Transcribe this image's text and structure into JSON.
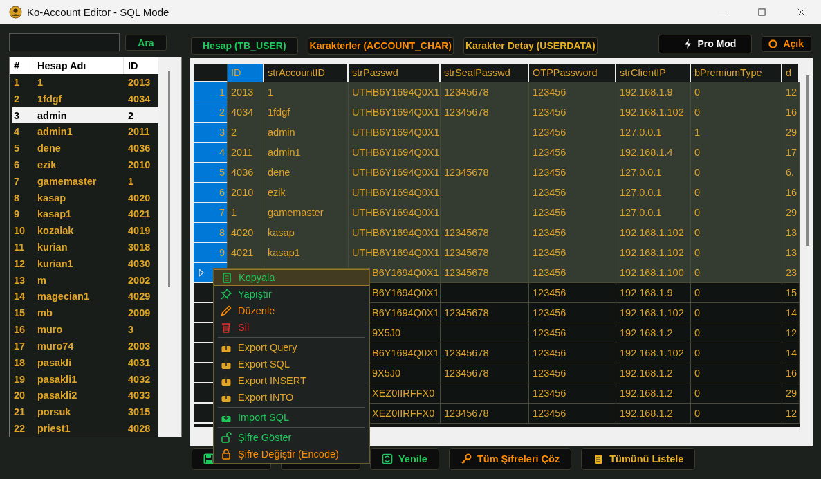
{
  "window": {
    "title": "Ko-Account Editor - SQL Mode"
  },
  "search": {
    "button": "Ara"
  },
  "account_list": {
    "columns": [
      "#",
      "Hesap Adı",
      "ID"
    ],
    "rows": [
      {
        "n": "1",
        "name": "1",
        "id": "2013",
        "selected": false
      },
      {
        "n": "2",
        "name": "1fdgf",
        "id": "4034",
        "selected": false
      },
      {
        "n": "3",
        "name": "admin",
        "id": "2",
        "selected": true
      },
      {
        "n": "4",
        "name": "admin1",
        "id": "2011",
        "selected": false
      },
      {
        "n": "5",
        "name": "dene",
        "id": "4036",
        "selected": false
      },
      {
        "n": "6",
        "name": "ezik",
        "id": "2010",
        "selected": false
      },
      {
        "n": "7",
        "name": "gamemaster",
        "id": "1",
        "selected": false
      },
      {
        "n": "8",
        "name": "kasap",
        "id": "4020",
        "selected": false
      },
      {
        "n": "9",
        "name": "kasap1",
        "id": "4021",
        "selected": false
      },
      {
        "n": "10",
        "name": "kozalak",
        "id": "4019",
        "selected": false
      },
      {
        "n": "11",
        "name": "kurian",
        "id": "3018",
        "selected": false
      },
      {
        "n": "12",
        "name": "kurian1",
        "id": "4030",
        "selected": false
      },
      {
        "n": "13",
        "name": "m",
        "id": "2002",
        "selected": false
      },
      {
        "n": "14",
        "name": "magecian1",
        "id": "4029",
        "selected": false
      },
      {
        "n": "15",
        "name": "mb",
        "id": "2009",
        "selected": false
      },
      {
        "n": "16",
        "name": "muro",
        "id": "3",
        "selected": false
      },
      {
        "n": "17",
        "name": "muro74",
        "id": "2003",
        "selected": false
      },
      {
        "n": "18",
        "name": "pasakli",
        "id": "4031",
        "selected": false
      },
      {
        "n": "19",
        "name": "pasakli1",
        "id": "4032",
        "selected": false
      },
      {
        "n": "20",
        "name": "pasakli2",
        "id": "4033",
        "selected": false
      },
      {
        "n": "21",
        "name": "porsuk",
        "id": "3015",
        "selected": false
      },
      {
        "n": "22",
        "name": "priest1",
        "id": "4028",
        "selected": false
      }
    ]
  },
  "tabs": [
    {
      "label": "Hesap (TB_USER)",
      "color": "#1ec85a"
    },
    {
      "label": "Karakterler (ACCOUNT_CHAR)",
      "color": "#ff8c00"
    },
    {
      "label": "Karakter Detay (USERDATA)",
      "color": "#e8b020"
    }
  ],
  "mode_buttons": [
    {
      "label": "Pro Mod",
      "kind": "bolt"
    },
    {
      "label": "Açık",
      "kind": "ring"
    }
  ],
  "grid": {
    "columns": [
      {
        "label": "ID",
        "selected": true
      },
      {
        "label": "strAccountID",
        "selected": false
      },
      {
        "label": "strPasswd",
        "selected": false
      },
      {
        "label": "strSealPasswd",
        "selected": false
      },
      {
        "label": "OTPPassword",
        "selected": false
      },
      {
        "label": "strClientIP",
        "selected": false
      },
      {
        "label": "bPremiumType",
        "selected": false
      },
      {
        "label": "d",
        "selected": false
      }
    ],
    "rows": [
      {
        "header": "1",
        "selected": true,
        "current": false,
        "cells": [
          "2013",
          "1",
          "UTHB6Y1694Q0X1",
          "12345678",
          "123456",
          "192.168.1.9",
          "0",
          "12"
        ]
      },
      {
        "header": "2",
        "selected": true,
        "current": false,
        "cells": [
          "4034",
          "1fdgf",
          "UTHB6Y1694Q0X1",
          "12345678",
          "123456",
          "192.168.1.102",
          "0",
          "16"
        ]
      },
      {
        "header": "3",
        "selected": true,
        "current": false,
        "cells": [
          "2",
          "admin",
          "UTHB6Y1694Q0X1",
          "",
          "123456",
          "127.0.0.1",
          "1",
          "29"
        ]
      },
      {
        "header": "4",
        "selected": true,
        "current": false,
        "cells": [
          "2011",
          "admin1",
          "UTHB6Y1694Q0X1",
          "",
          "123456",
          "192.168.1.4",
          "0",
          "17"
        ]
      },
      {
        "header": "5",
        "selected": true,
        "current": false,
        "cells": [
          "4036",
          "dene",
          "UTHB6Y1694Q0X1",
          "12345678",
          "123456",
          "127.0.0.1",
          "0",
          "6."
        ]
      },
      {
        "header": "6",
        "selected": true,
        "current": false,
        "cells": [
          "2010",
          "ezik",
          "UTHB6Y1694Q0X1",
          "",
          "123456",
          "127.0.0.1",
          "0",
          "16"
        ]
      },
      {
        "header": "7",
        "selected": true,
        "current": false,
        "cells": [
          "1",
          "gamemaster",
          "UTHB6Y1694Q0X1",
          "",
          "123456",
          "127.0.0.1",
          "0",
          "29"
        ]
      },
      {
        "header": "8",
        "selected": true,
        "current": false,
        "cells": [
          "4020",
          "kasap",
          "UTHB6Y1694Q0X1",
          "12345678",
          "123456",
          "192.168.1.102",
          "0",
          "13"
        ]
      },
      {
        "header": "9",
        "selected": true,
        "current": false,
        "cells": [
          "4021",
          "kasap1",
          "UTHB6Y1694Q0X1",
          "12345678",
          "123456",
          "192.168.1.102",
          "0",
          "13"
        ]
      },
      {
        "selected": true,
        "current": true,
        "cells": [
          "B6Y1694Q0X1",
          "12345678",
          "123456",
          "192.168.1.100",
          "0",
          "23"
        ]
      },
      {
        "selected": false,
        "current": false,
        "cells": [
          "B6Y1694Q0X1",
          "",
          "123456",
          "192.168.1.9",
          "0",
          "15"
        ]
      },
      {
        "selected": false,
        "current": false,
        "cells": [
          "B6Y1694Q0X1",
          "12345678",
          "123456",
          "192.168.1.102",
          "0",
          "14"
        ]
      },
      {
        "selected": false,
        "current": false,
        "cells": [
          "9X5J0",
          "",
          "123456",
          "192.168.1.2",
          "0",
          "12"
        ]
      },
      {
        "selected": false,
        "current": false,
        "cells": [
          "B6Y1694Q0X1",
          "12345678",
          "123456",
          "192.168.1.102",
          "0",
          "14"
        ]
      },
      {
        "selected": false,
        "current": false,
        "cells": [
          "9X5J0",
          "12345678",
          "123456",
          "192.168.1.2",
          "0",
          "16"
        ]
      },
      {
        "selected": false,
        "current": false,
        "cells": [
          "XEZ0IIRFFX0",
          "",
          "123456",
          "192.168.1.2",
          "0",
          "29"
        ]
      },
      {
        "selected": false,
        "current": false,
        "cells": [
          "XEZ0IIRFFX0",
          "12345678",
          "123456",
          "192.168.1.2",
          "0",
          "12"
        ]
      }
    ]
  },
  "bottom_buttons": [
    {
      "kind": "save",
      "color": "#1ec85a"
    },
    {
      "kind": "none"
    },
    {
      "label": "Yenile",
      "kind": "refresh",
      "color": "#1ec85a"
    },
    {
      "label": "Tüm Şifreleri Çöz",
      "kind": "key",
      "color": "#ff8c00"
    },
    {
      "label": "Tümünü Listele",
      "kind": "clipboard",
      "color": "#e8b020"
    }
  ],
  "context_menu": [
    [
      {
        "label": "Kopyala",
        "kind": "clipboard",
        "color": "#1ec85a",
        "selected": true
      },
      {
        "label": "Yapıştır",
        "kind": "pin",
        "color": "#1ec85a",
        "selected": false
      },
      {
        "label": "Düzenle",
        "kind": "pencil",
        "color": "#ff8c00",
        "selected": false
      },
      {
        "label": "Sil",
        "kind": "trash",
        "color": "#e03030",
        "selected": false
      }
    ],
    [
      {
        "label": "Export Query",
        "kind": "export",
        "color": "#e0a526",
        "selected": false
      },
      {
        "label": "Export SQL",
        "kind": "export",
        "color": "#e0a526",
        "selected": false
      },
      {
        "label": "Export INSERT",
        "kind": "export",
        "color": "#e0a526",
        "selected": false
      },
      {
        "label": "Export INTO",
        "kind": "export",
        "color": "#e0a526",
        "selected": false
      }
    ],
    [
      {
        "label": "Import SQL",
        "kind": "import",
        "color": "#1ec85a",
        "selected": false
      }
    ],
    [
      {
        "label": "Şifre Göster",
        "kind": "unlock",
        "color": "#1ec85a",
        "selected": false
      },
      {
        "label": "Şifre Değiştir (Encode)",
        "kind": "lock",
        "color": "#ff8c00",
        "selected": false
      }
    ]
  ]
}
